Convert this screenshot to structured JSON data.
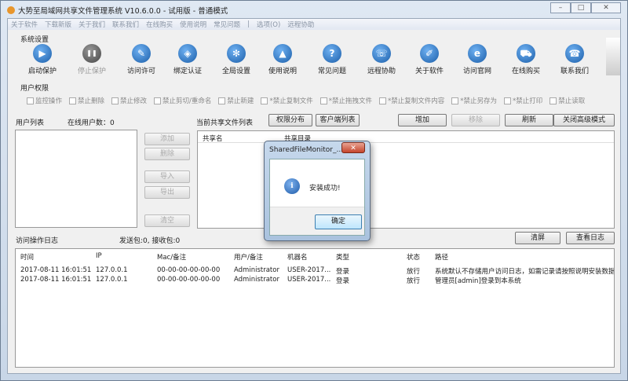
{
  "window": {
    "title": "大势至局域网共享文件管理系统 V10.6.0.0 - 试用版 - 普通模式",
    "minimize": "–",
    "maximize": "□",
    "close": "✕"
  },
  "menu": [
    "关于软件",
    "下载新版",
    "关于我们",
    "联系我们",
    "在线购买",
    "使用说明",
    "常见问题",
    "|",
    "选项(O)",
    "远程协助"
  ],
  "system_settings": {
    "label": "系统设置",
    "tools": [
      {
        "label": "启动保护",
        "icon": "play-icon",
        "glyph": "▶"
      },
      {
        "label": "停止保护",
        "icon": "pause-icon",
        "glyph": "❚❚",
        "disabled": true
      },
      {
        "label": "访问许可",
        "icon": "key-icon",
        "glyph": "✎"
      },
      {
        "label": "绑定认证",
        "icon": "shield-icon",
        "glyph": "◈"
      },
      {
        "label": "全局设置",
        "icon": "gear-icon",
        "glyph": "✻"
      },
      {
        "label": "使用说明",
        "icon": "graduation-icon",
        "glyph": "▲"
      },
      {
        "label": "常见问题",
        "icon": "question-icon",
        "glyph": "?"
      },
      {
        "label": "远程协助",
        "icon": "remote-icon",
        "glyph": "☏"
      },
      {
        "label": "关于软件",
        "icon": "about-icon",
        "glyph": "✐"
      },
      {
        "label": "访问官网",
        "icon": "ie-icon",
        "glyph": "e"
      },
      {
        "label": "在线购买",
        "icon": "cart-icon",
        "glyph": "⛟"
      },
      {
        "label": "联系我们",
        "icon": "phone-icon",
        "glyph": "☎"
      }
    ]
  },
  "permissions": {
    "label": "用户权限",
    "items": [
      "监控操作",
      "禁止删除",
      "禁止修改",
      "禁止剪切/重命名",
      "禁止新建",
      "*禁止复制文件",
      "*禁止拖拽文件",
      "*禁止复制文件内容",
      "*禁止另存为",
      "*禁止打印",
      "禁止读取"
    ]
  },
  "user_list": {
    "label": "用户列表",
    "online": "在线用户数：0",
    "buttons": [
      "添加",
      "删除",
      "导入",
      "导出",
      "清空"
    ]
  },
  "share_list": {
    "label": "当前共享文件列表",
    "perm_dist": "权限分布",
    "client_list": "客户端列表",
    "add": "增加",
    "remove": "移除",
    "refresh": "刷新",
    "close_adv": "关闭高级模式",
    "columns": [
      "共享名",
      "共享目录"
    ]
  },
  "log": {
    "label": "访问操作日志",
    "packets": "发送包:0, 接收包:0",
    "clear": "清屏",
    "view": "查看日志",
    "columns": [
      "时间",
      "IP",
      "Mac/备注",
      "用户/备注",
      "机器名",
      "类型",
      "状态",
      "路径"
    ],
    "rows": [
      [
        "2017-08-11 16:01:51",
        "127.0.0.1",
        "00-00-00-00-00-00",
        "Administrator",
        "USER-2017...",
        "登录",
        "放行",
        "系统默认不存储用户访问日志，如需记录请按照说明安装数据库"
      ],
      [
        "2017-08-11 16:01:51",
        "127.0.0.1",
        "00-00-00-00-00-00",
        "Administrator",
        "USER-2017...",
        "登录",
        "放行",
        "管理员[admin]登录到本系统"
      ]
    ]
  },
  "dialog": {
    "title": "SharedFileMonitor_...",
    "message": "安装成功!",
    "ok": "确定",
    "close": "✕",
    "icon": "info-icon",
    "glyph": "i"
  }
}
